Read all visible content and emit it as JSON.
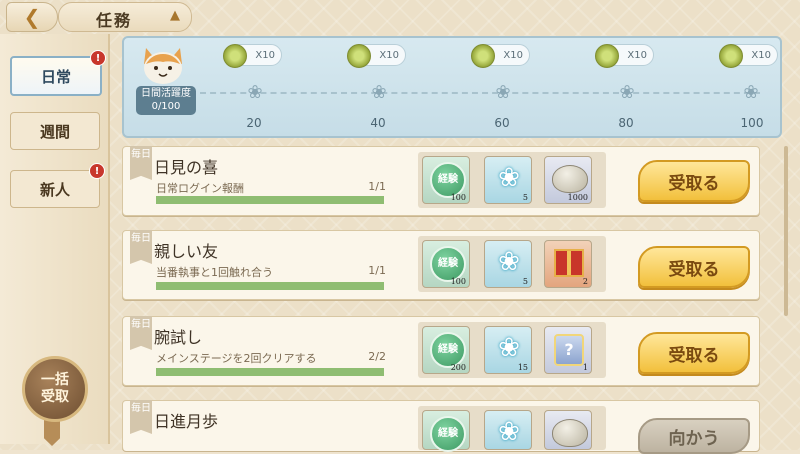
{
  "header": {
    "back_icon": "back-arrow-icon",
    "title": "任務"
  },
  "sidebar": {
    "items": [
      {
        "label": "日常",
        "active": true,
        "badge": "!"
      },
      {
        "label": "週間",
        "active": false,
        "badge": ""
      },
      {
        "label": "新人",
        "active": false,
        "badge": "!"
      }
    ],
    "claim_all": {
      "line1": "一括",
      "line2": "受取"
    }
  },
  "activity": {
    "label_line1": "日間活躍度",
    "label_line2": "0/100",
    "milestones": [
      {
        "reward": "X10",
        "threshold": "20"
      },
      {
        "reward": "X10",
        "threshold": "40"
      },
      {
        "reward": "X10",
        "threshold": "60"
      },
      {
        "reward": "X10",
        "threshold": "80"
      },
      {
        "reward": "X10",
        "threshold": "100"
      }
    ]
  },
  "tasks": [
    {
      "tag": "毎日",
      "name": "日見の喜",
      "desc": "日常ログイン報酬",
      "progress": "1/1",
      "progress_value": 1.0,
      "rewards": [
        {
          "type": "exp",
          "label": "経験",
          "count": "100"
        },
        {
          "type": "paw",
          "count": "5"
        },
        {
          "type": "shell",
          "count": "1000"
        }
      ],
      "button": "受取る"
    },
    {
      "tag": "毎日",
      "name": "親しい友",
      "desc": "当番執事と1回触れ合う",
      "progress": "1/1",
      "progress_value": 1.0,
      "rewards": [
        {
          "type": "exp",
          "label": "経験",
          "count": "100"
        },
        {
          "type": "paw",
          "count": "5"
        },
        {
          "type": "gift",
          "count": "2"
        }
      ],
      "button": "受取る"
    },
    {
      "tag": "毎日",
      "name": "腕試し",
      "desc": "メインステージを2回クリアする",
      "progress": "2/2",
      "progress_value": 1.0,
      "rewards": [
        {
          "type": "exp",
          "label": "経験",
          "count": "200"
        },
        {
          "type": "paw",
          "count": "15"
        },
        {
          "type": "card",
          "label": "?",
          "count": "1"
        }
      ],
      "button": "受取る"
    },
    {
      "tag": "毎日",
      "name": "日進月歩",
      "desc": "",
      "progress": "",
      "progress_value": 0,
      "rewards": [
        {
          "type": "exp",
          "label": "経験",
          "count": ""
        },
        {
          "type": "paw",
          "count": ""
        },
        {
          "type": "shell",
          "count": ""
        }
      ],
      "button": "向かう"
    }
  ]
}
